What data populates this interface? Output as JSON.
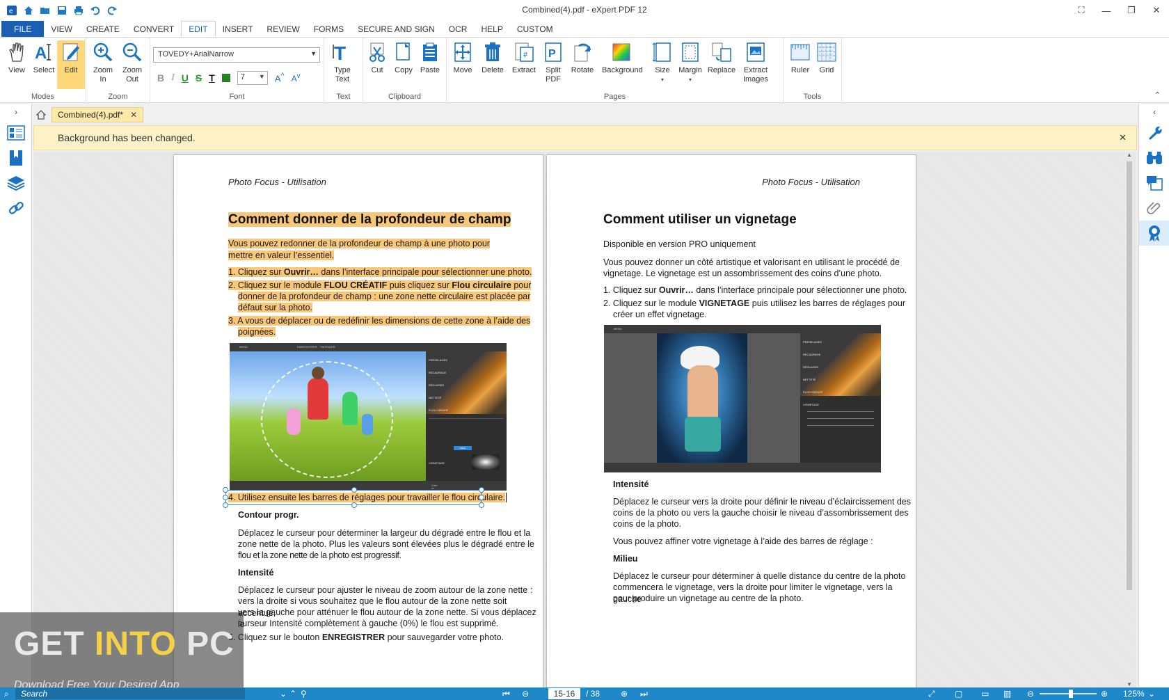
{
  "window": {
    "title": "Combined(4).pdf   -   eXpert PDF 12"
  },
  "quick_access": [
    "app-logo-icon",
    "home-icon",
    "open-icon",
    "save-icon",
    "print-icon",
    "undo-icon",
    "redo-icon"
  ],
  "menu_tabs": [
    "FILE",
    "VIEW",
    "CREATE",
    "CONVERT",
    "EDIT",
    "INSERT",
    "REVIEW",
    "FORMS",
    "SECURE AND SIGN",
    "OCR",
    "HELP",
    "CUSTOM"
  ],
  "ribbon": {
    "modes": {
      "label": "Modes",
      "view": "View",
      "select": "Select",
      "edit": "Edit"
    },
    "zoom": {
      "label": "Zoom",
      "zoom_in": "Zoom\nIn",
      "zoom_out": "Zoom\nOut"
    },
    "font": {
      "label": "Font",
      "family": "TOVEDY+ArialNarrow",
      "size": "7"
    },
    "text": {
      "label": "Text",
      "type_text": "Type\nText"
    },
    "clipboard": {
      "label": "Clipboard",
      "cut": "Cut",
      "copy": "Copy",
      "paste": "Paste"
    },
    "pages": {
      "label": "Pages",
      "move": "Move",
      "delete": "Delete",
      "extract": "Extract",
      "split_pdf": "Split\nPDF",
      "rotate": "Rotate",
      "background": "Background",
      "size": "Size",
      "margin": "Margin",
      "replace": "Replace",
      "extract_images": "Extract\nImages"
    },
    "tools": {
      "label": "Tools",
      "ruler": "Ruler",
      "grid": "Grid"
    }
  },
  "doc_tab": {
    "name": "Combined(4).pdf*"
  },
  "notification": "Background has been changed.",
  "left_page": {
    "running_head": "Photo Focus - Utilisation",
    "heading": "Comment donner de la profondeur de champ",
    "intro": "Vous pouvez redonner de la profondeur de champ à une photo pour mettre en valeur l’essentiel.",
    "step1_a": "1. Cliquez sur ",
    "step1_b": "Ouvrir…",
    "step1_c": " dans l’interface principale pour sélectionner une photo.",
    "step2_a": "2. Cliquez sur le module ",
    "step2_b": "FLOU CRÉATIF",
    "step2_c": " puis cliquez sur ",
    "step2_d": "Flou circulaire",
    "step2_e": " pour",
    "step2_line2": "donner de la profondeur de champ : une zone nette circulaire est placée par",
    "step2_line3": "défaut sur la photo.",
    "step3_line1": "3. A vous de déplacer ou de redéfinir les dimensions de cette zone à l’aide des",
    "step3_line2": "poignées.",
    "step4": "4. Utilisez ensuite les barres de réglages pour travailler le flou circulaire.",
    "contour_title": "Contour progr.",
    "contour_text_1": "Déplacez le curseur pour déterminer la largeur du dégradé entre le flou et la",
    "contour_text_2": "zone nette de la photo. Plus les valeurs sont élevées plus le dégradé entre le",
    "contour_text_3": "flou et la zone nette de la photo est progressif.",
    "intensite_title": "Intensité",
    "intensite_1": "Déplacez le curseur pour ajuster le niveau de  zoom autour de la zone nette :",
    "intensite_2": "vers la droite si vous souhaitez que le flou autour de la zone nette soit accentué,",
    "intensite_3": "vers la gauche pour atténuer le flou autour de la zone nette. Si vous déplacez le",
    "intensite_4": "curseur Intensité complètement à gauche (0%) le flou est supprimé.",
    "step5_a": "5. Cliquez  sur le bouton ",
    "step5_b": "ENREGISTRER",
    "step5_c": " pour sauvegarder votre photo."
  },
  "right_page": {
    "running_head": "Photo Focus - Utilisation",
    "heading": "Comment utiliser un vignetage",
    "pro": "Disponible en version PRO uniquement",
    "intro_1": "Vous pouvez donner un côté artistique et valorisant en utilisant le procédé de",
    "intro_2": "vignetage. Le vignetage est un assombrissement des coins d’une photo.",
    "step1_a": "1. Cliquez sur ",
    "step1_b": "Ouvrir…",
    "step1_c": " dans l’interface principale pour sélectionner une photo.",
    "step2_a": "2. Cliquez sur le module ",
    "step2_b": "VIGNETAGE",
    "step2_c": " puis utilisez les barres de réglages pour",
    "step2_line2": "créer un effet vignetage.",
    "intensite_title": "Intensité",
    "intensite_1": "Déplacez le curseur vers la droite pour définir le niveau d’éclaircissement des",
    "intensite_2": "coins de la photo ou vers la gauche choisir le niveau d’assombrissement des",
    "intensite_3": "coins de la photo.",
    "affiner": "Vous pouvez affiner votre vignetage à l’aide des barres de réglage :",
    "milieu_title": "Milieu",
    "milieu_1": "Déplacez le curseur pour déterminer à quelle distance du centre de la photo",
    "milieu_2": "commencera le vignetage, vers la droite pour limiter le vignetage, vers la gauche",
    "milieu_3": "pour produire un vignetage au centre de la photo."
  },
  "screenshot_ui": {
    "menu": "MENU",
    "enregistrer": "ENREGISTRER",
    "partager": "PARTAGER",
    "panels": [
      "PRÉSELAGES",
      "RECADRAGE",
      "RÉGLAGES",
      "NETTETÉ",
      "FLOU CRÉATIF",
      "VIGNETAGE"
    ],
    "validate": "Valider",
    "hint": "Créer un préréglage avec les réglages actuels"
  },
  "status": {
    "search_placeholder": "Search",
    "page_field": "15-16",
    "page_total": "/ 38",
    "zoom": "125%"
  },
  "watermark": {
    "line1_a": "GET ",
    "line1_b": "INTO",
    "line1_c": " PC",
    "line2": "Download Free Your Desired App"
  },
  "colors": {
    "accent": "#1a5fb4",
    "highlight": "#f9c77a",
    "status_bar": "#1e88c8",
    "notify": "#fcf2c6"
  }
}
